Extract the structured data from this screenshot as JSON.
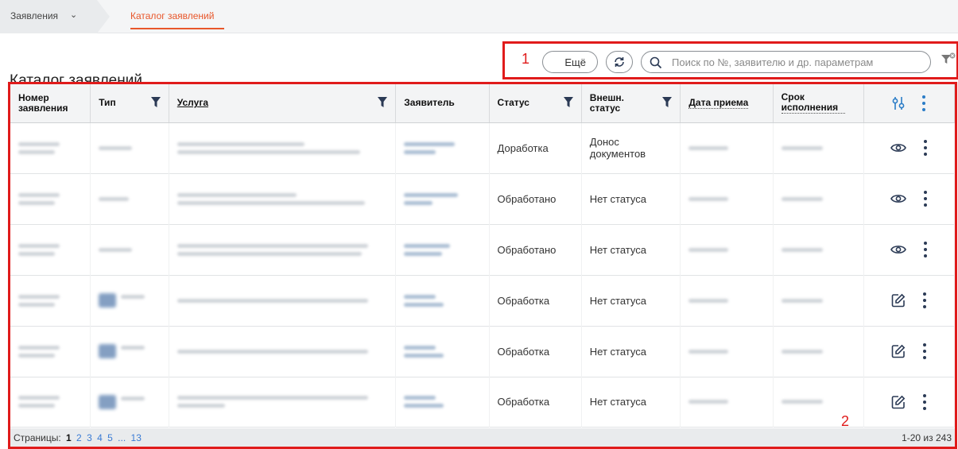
{
  "breadcrumb": {
    "root": "Заявления",
    "current": "Каталог заявлений"
  },
  "page_title": "Каталог заявлений",
  "toolbar": {
    "more_label": "Ещё",
    "search_placeholder": "Поиск по №, заявителю и др. параметрам"
  },
  "annotations": {
    "box1": "1",
    "box2": "2"
  },
  "table": {
    "columns": [
      "Номер заявления",
      "Тип",
      "Услуга",
      "Заявитель",
      "Статус",
      "Внешн. статус",
      "Дата приема",
      "Срок исполнения"
    ],
    "rows": [
      {
        "status": "Доработка",
        "ext_status": "Донос документов",
        "action": "view"
      },
      {
        "status": "Обработано",
        "ext_status": "Нет статуса",
        "action": "view"
      },
      {
        "status": "Обработано",
        "ext_status": "Нет статуса",
        "action": "view"
      },
      {
        "status": "Обработка",
        "ext_status": "Нет статуса",
        "action": "edit"
      },
      {
        "status": "Обработка",
        "ext_status": "Нет статуса",
        "action": "edit"
      },
      {
        "status": "Обработка",
        "ext_status": "Нет статуса",
        "action": "edit"
      }
    ]
  },
  "pager": {
    "label": "Страницы:",
    "pages": [
      "1",
      "2",
      "3",
      "4",
      "5",
      "...",
      "13"
    ],
    "current": "1",
    "count": "1-20 из 243"
  },
  "colors": {
    "accent": "#e8562a",
    "annotation": "#e01b1b",
    "filter_icon": "#2b3a55",
    "link": "#3a7bd5"
  }
}
